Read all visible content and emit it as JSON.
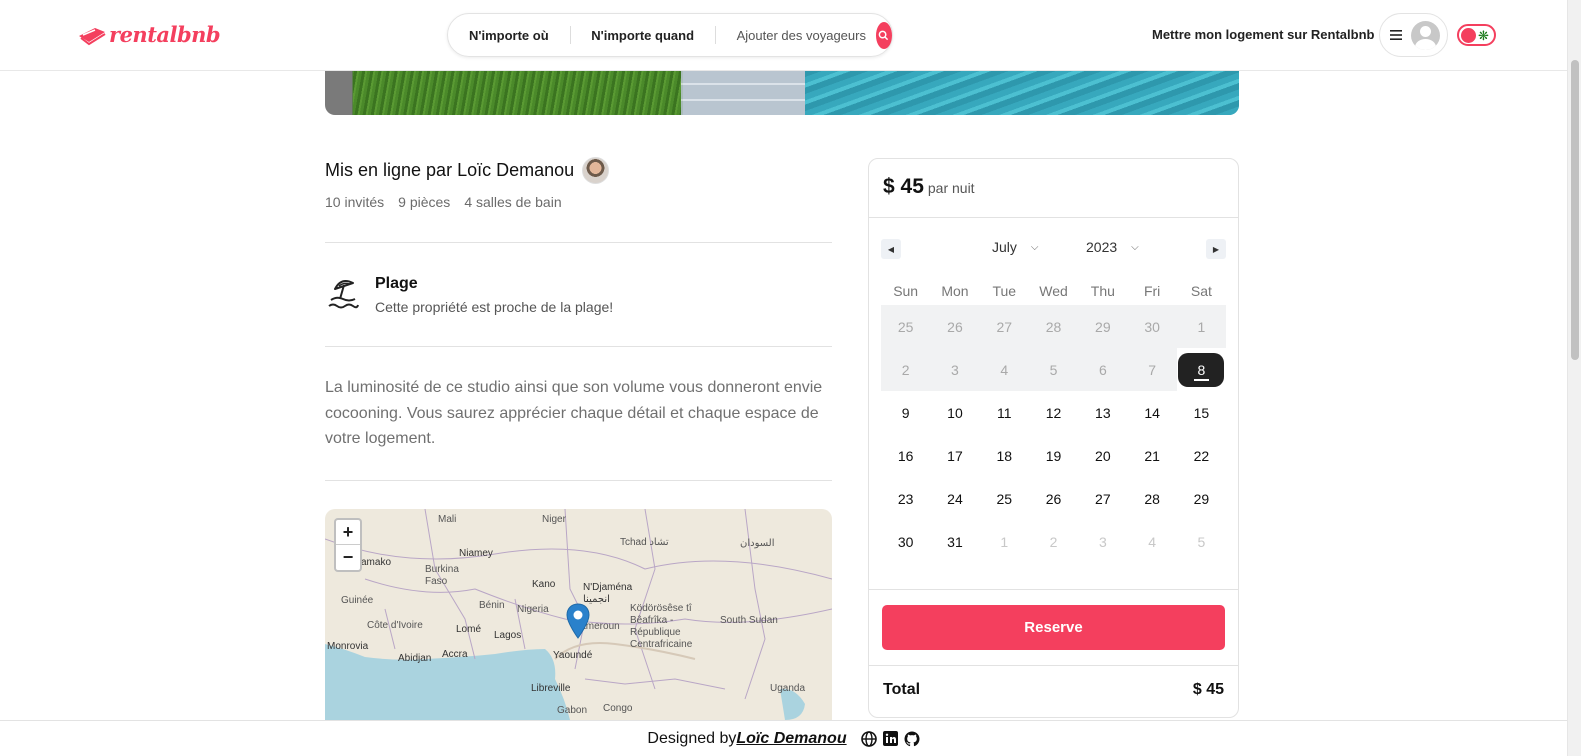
{
  "header": {
    "logo_text": "rentalbnb",
    "search": {
      "anywhere": "N'importe où",
      "anytime": "N'importe quand",
      "guests": "Ajouter des voyageurs"
    },
    "host_link": "Mettre mon logement sur Rentalbnb",
    "accent_color": "#f43f5e"
  },
  "listing": {
    "host_title": "Mis en ligne par Loïc Demanou",
    "stats": {
      "guests": "10 invités",
      "rooms": "9 pièces",
      "bathrooms": "4 salles de bain"
    },
    "category": {
      "icon": "beach-umbrella-icon",
      "title": "Plage",
      "subtitle": "Cette propriété est proche de la plage!"
    },
    "description": "La luminosité de ce studio ainsi que son volume vous donneront envie cocooning. Vous saurez apprécier chaque détail et chaque espace de votre logement."
  },
  "map": {
    "zoom_in": "+",
    "zoom_out": "−",
    "labels": {
      "mali": "Mali",
      "niger": "Niger",
      "tchad": "Tchad تشاد",
      "sudan": "السودان",
      "niamey": "Niamey",
      "burkina": "Burkina Faso",
      "bamako": "amako",
      "kano": "Kano",
      "ndjamena": "N'Djaména انجمينا",
      "guinee": "Guinée",
      "nigeria": "Nigeria",
      "benin": "Bénin",
      "cote": "Côte d'Ivoire",
      "lome": "Lomé",
      "lagos": "Lagos",
      "cameroun": "Cameroun",
      "centrafrique": "Ködörösêse tî Bêafrîka - République Centrafricaine",
      "southsudan": "South Sudan",
      "monrovia": "Monrovia",
      "abidjan": "Abidjan",
      "accra": "Accra",
      "yaounde": "Yaoundé",
      "libreville": "Libreville",
      "gabon": "Gabon",
      "congo": "Congo",
      "uganda": "Uganda"
    }
  },
  "booking": {
    "price": "$ 45",
    "per_night": "par nuit",
    "month": "July",
    "year": "2023",
    "weekdays": [
      "Sun",
      "Mon",
      "Tue",
      "Wed",
      "Thu",
      "Fri",
      "Sat"
    ],
    "weeks": [
      [
        {
          "d": "25",
          "s": "past"
        },
        {
          "d": "26",
          "s": "past"
        },
        {
          "d": "27",
          "s": "past"
        },
        {
          "d": "28",
          "s": "past"
        },
        {
          "d": "29",
          "s": "past"
        },
        {
          "d": "30",
          "s": "past"
        },
        {
          "d": "1",
          "s": "past"
        }
      ],
      [
        {
          "d": "2",
          "s": "past"
        },
        {
          "d": "3",
          "s": "past"
        },
        {
          "d": "4",
          "s": "past"
        },
        {
          "d": "5",
          "s": "past"
        },
        {
          "d": "6",
          "s": "past"
        },
        {
          "d": "7",
          "s": "past"
        },
        {
          "d": "8",
          "s": "today"
        }
      ],
      [
        {
          "d": "9",
          "s": "normal"
        },
        {
          "d": "10",
          "s": "normal"
        },
        {
          "d": "11",
          "s": "normal"
        },
        {
          "d": "12",
          "s": "normal"
        },
        {
          "d": "13",
          "s": "normal"
        },
        {
          "d": "14",
          "s": "normal"
        },
        {
          "d": "15",
          "s": "normal"
        }
      ],
      [
        {
          "d": "16",
          "s": "normal"
        },
        {
          "d": "17",
          "s": "normal"
        },
        {
          "d": "18",
          "s": "normal"
        },
        {
          "d": "19",
          "s": "normal"
        },
        {
          "d": "20",
          "s": "normal"
        },
        {
          "d": "21",
          "s": "normal"
        },
        {
          "d": "22",
          "s": "normal"
        }
      ],
      [
        {
          "d": "23",
          "s": "normal"
        },
        {
          "d": "24",
          "s": "normal"
        },
        {
          "d": "25",
          "s": "normal"
        },
        {
          "d": "26",
          "s": "normal"
        },
        {
          "d": "27",
          "s": "normal"
        },
        {
          "d": "28",
          "s": "normal"
        },
        {
          "d": "29",
          "s": "normal"
        }
      ],
      [
        {
          "d": "30",
          "s": "normal"
        },
        {
          "d": "31",
          "s": "normal"
        },
        {
          "d": "1",
          "s": "other"
        },
        {
          "d": "2",
          "s": "other"
        },
        {
          "d": "3",
          "s": "other"
        },
        {
          "d": "4",
          "s": "other"
        },
        {
          "d": "5",
          "s": "other"
        }
      ]
    ],
    "reserve_label": "Reserve",
    "total_label": "Total",
    "total_value": "$ 45"
  },
  "footer": {
    "designed_by": "Designed by",
    "author": "Loïc Demanou",
    "icons": [
      "globe-icon",
      "linkedin-icon",
      "github-icon"
    ]
  }
}
